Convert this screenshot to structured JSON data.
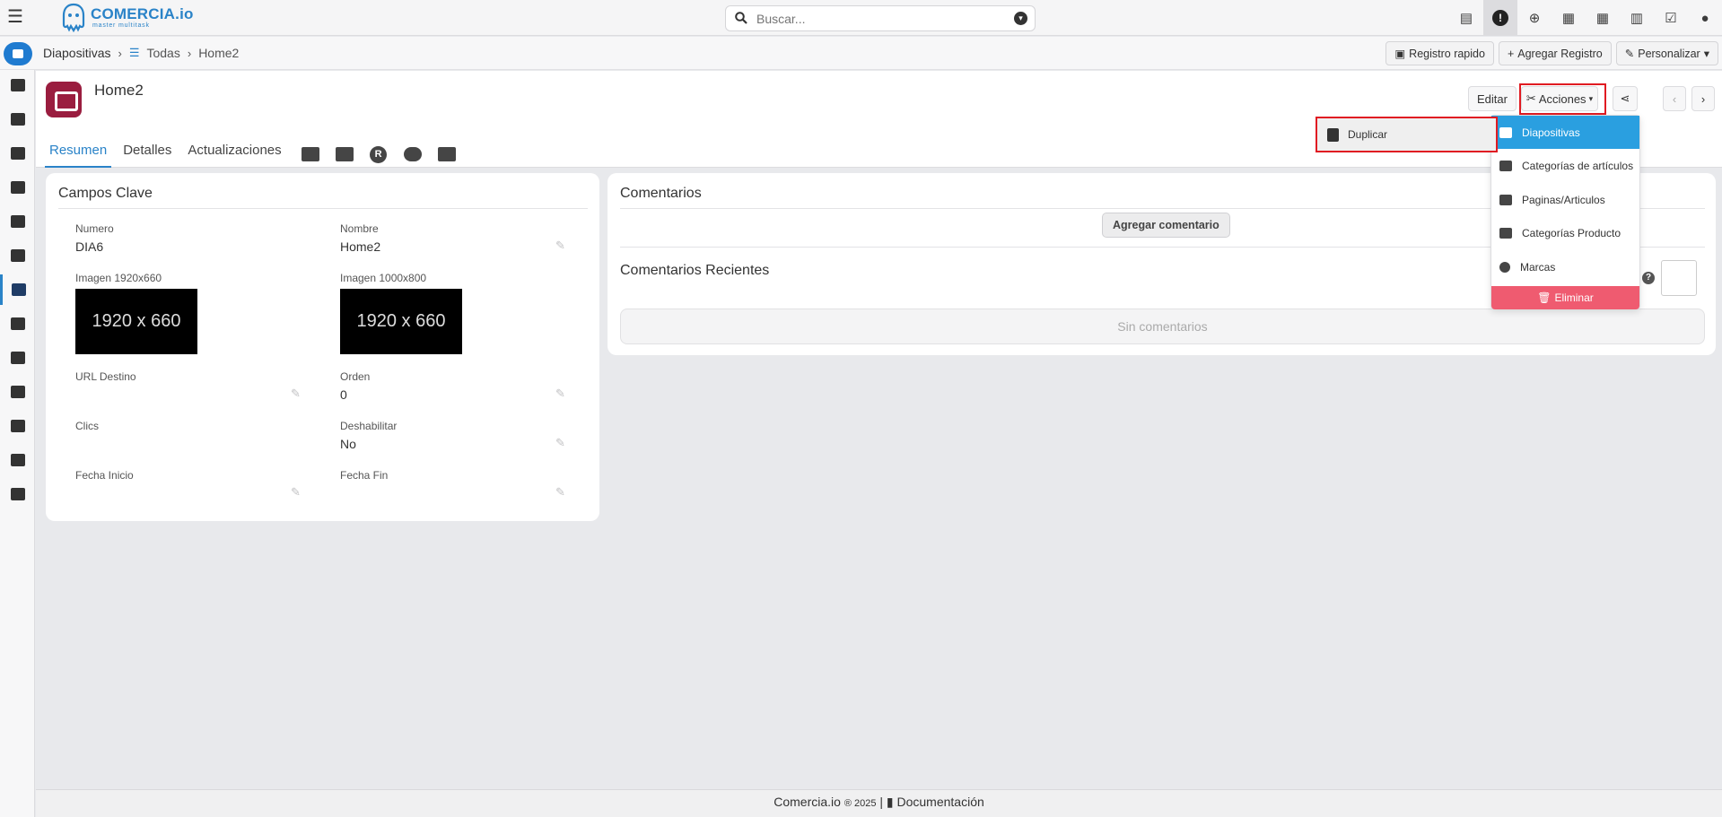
{
  "topbar": {
    "logo_text": "COMERCIA.io",
    "logo_sub": "master multitask",
    "search_placeholder": "Buscar...",
    "icons": [
      "calculator-icon",
      "alert-icon",
      "plus-circle-icon",
      "calendar-check-icon",
      "calendar-icon",
      "bar-chart-icon",
      "check-square-icon",
      "user-icon"
    ]
  },
  "breadcrumb": {
    "module": "Diapositivas",
    "list": "Todas",
    "record": "Home2"
  },
  "toolbar": {
    "quick_record": "Registro rapido",
    "add_record": "Agregar Registro",
    "customize": "Personalizar"
  },
  "record": {
    "title": "Home2",
    "tabs": [
      "Resumen",
      "Detalles",
      "Actualizaciones"
    ],
    "edit_label": "Editar",
    "actions_label": "Acciones"
  },
  "key_fields": {
    "title": "Campos Clave",
    "numero_label": "Numero",
    "numero_value": "DIA6",
    "nombre_label": "Nombre",
    "nombre_value": "Home2",
    "img1_label": "Imagen 1920x660",
    "img1_text": "1920 x 660",
    "img2_label": "Imagen 1000x800",
    "img2_text": "1920 x 660",
    "url_label": "URL Destino",
    "orden_label": "Orden",
    "orden_value": "0",
    "clics_label": "Clics",
    "deshab_label": "Deshabilitar",
    "deshab_value": "No",
    "fini_label": "Fecha Inicio",
    "ffin_label": "Fecha Fin"
  },
  "comments": {
    "title": "Comentarios",
    "add_label": "Agregar comentario",
    "recent_title": "Comentarios Recientes",
    "empty_label": "Sin comentarios"
  },
  "actions_menu": {
    "duplicate": "Duplicar",
    "items": [
      "Diapositivas",
      "Categorías de artículos",
      "Paginas/Articulos",
      "Categorías Producto",
      "Marcas"
    ],
    "delete": "Eliminar"
  },
  "footer": {
    "brand": "Comercia.io",
    "year": "® 2025",
    "sep": "|",
    "docs": "Documentación"
  },
  "colors": {
    "accent": "#2a83c8",
    "record_icon": "#9a1d3f",
    "selected_item": "#2a9fe0",
    "delete": "#ef5b70",
    "highlight": "#e01b22"
  }
}
